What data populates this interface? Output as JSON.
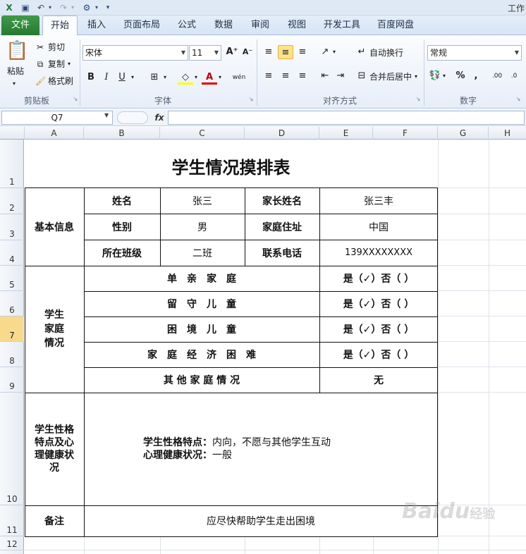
{
  "window": {
    "title": "工作"
  },
  "tabs": [
    "文件",
    "开始",
    "插入",
    "页面布局",
    "公式",
    "数据",
    "审阅",
    "视图",
    "开发工具",
    "百度网盘"
  ],
  "ribbon": {
    "clipboard": {
      "paste": "粘贴",
      "cut": "剪切",
      "copy": "复制",
      "format_painter": "格式刷",
      "label": "剪贴板"
    },
    "font": {
      "name": "宋体",
      "size": "11",
      "label": "字体"
    },
    "alignment": {
      "wrap": "自动换行",
      "merge": "合并后居中",
      "label": "对齐方式"
    },
    "number": {
      "format": "常规",
      "label": "数字"
    }
  },
  "formula_bar": {
    "cell_ref": "Q7",
    "fx": "fx",
    "content": ""
  },
  "columns": [
    "A",
    "B",
    "C",
    "D",
    "E",
    "F",
    "G",
    "H"
  ],
  "rows": [
    "1",
    "2",
    "3",
    "4",
    "5",
    "6",
    "7",
    "8",
    "9",
    "10",
    "11",
    "12"
  ],
  "selected_row": "7",
  "sheet": {
    "title": "学生情况摸排表",
    "basic_info_label": "基本信息",
    "name_label": "姓名",
    "name_value": "张三",
    "parent_label": "家长姓名",
    "parent_value": "张三丰",
    "gender_label": "性别",
    "gender_value": "男",
    "address_label": "家庭住址",
    "address_value": "中国",
    "class_label": "所在班级",
    "class_value": "二班",
    "phone_label": "联系电话",
    "phone_value": "139XXXXXXXX",
    "family_label_1": "学生",
    "family_label_2": "家庭",
    "family_label_3": "情况",
    "single_parent": "单　亲　家　庭",
    "left_behind": "留　守　儿　童",
    "hardship": "困　境　儿　童",
    "economic": "家　庭　经　济　困　难",
    "other_family": "其 他 家 庭 情 况",
    "yes_no_answer": "是（✓）否（ ）",
    "other_value": "无",
    "personality_label_1": "学生性格",
    "personality_label_2": "特点及心",
    "personality_label_3": "理健康状",
    "personality_label_4": "况",
    "personality_key": "学生性格特点：",
    "personality_value": "内向，不愿与其他学生互动",
    "health_key": "心理健康状况：",
    "health_value": "一般",
    "remarks_label": "备注",
    "remarks_value": "应尽快帮助学生走出困境"
  },
  "watermark": {
    "brand": "Baidu",
    "suffix": "经验"
  }
}
